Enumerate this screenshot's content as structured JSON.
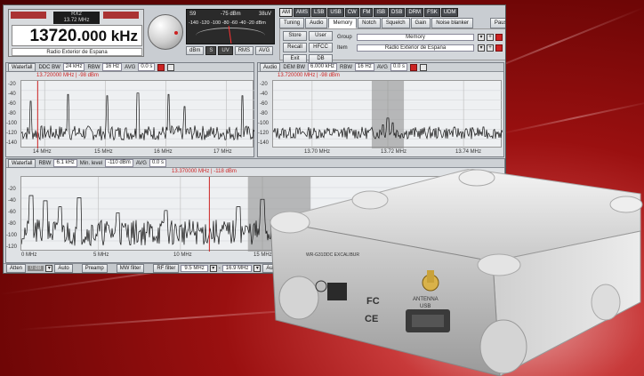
{
  "rx": {
    "label": "RX2",
    "sub": "13.72 MHz"
  },
  "frequency": {
    "main": "13720.",
    "unit": "000 kHz"
  },
  "station": "Radio Exterior de Espana",
  "meter": {
    "s_label": "S9",
    "dbm": "-75 dBm",
    "uv": "38uV",
    "scale": "-140 -120 -100 -80 -60 -40 -20 dBm"
  },
  "meter_buttons": [
    "dBm",
    "S",
    "UV",
    "RMS",
    "AVG"
  ],
  "modes": [
    "AM",
    "AMS",
    "LSB",
    "USB",
    "CW",
    "FM",
    "ISB",
    "DSB",
    "DRM",
    "FSK",
    "UDM"
  ],
  "tabs": [
    "Tuning",
    "Audio",
    "Memory",
    "Notch",
    "Squelch",
    "Gain",
    "Noise blanker",
    "Pause"
  ],
  "memory": {
    "buttons": [
      "Store",
      "User",
      "Recall",
      "HFCC",
      "Exit",
      "DB"
    ],
    "group_label": "Group",
    "group_value": "Memory",
    "item_label": "Item",
    "item_value": "Radio Exterior de Espana"
  },
  "waterfall1": {
    "label": "Waterfall",
    "ddc_label": "DDC BW",
    "ddc_value": "24 kHz",
    "rbw_label": "RBW",
    "rbw_value": "16 Hz",
    "avg_label": "AVG",
    "avg_value": "0.0 s",
    "marker": "13.720000 MHz | -98 dBm",
    "y_ticks": [
      "-20",
      "-40",
      "-60",
      "-80",
      "-100",
      "-120",
      "-140"
    ],
    "x_ticks": [
      "14 MHz",
      "15 MHz",
      "16 MHz",
      "17 MHz"
    ]
  },
  "audio": {
    "label": "Audio",
    "dem_label": "DEM BW",
    "dem_value": "6.000 kHz",
    "rbw_label": "RBW",
    "rbw_value": "16 Hz",
    "avg_label": "AVG",
    "avg_value": "0.0 s",
    "marker": "13.720000 MHz | -98 dBm",
    "y_ticks": [
      "-20",
      "-40",
      "-60",
      "-80",
      "-100",
      "-120",
      "-140"
    ],
    "x_ticks": [
      "13.70 MHz",
      "13.72 MHz",
      "13.74 MHz"
    ]
  },
  "waterfall2": {
    "label": "Waterfall",
    "rbw_label": "RBW",
    "rbw_value": "6.1 kHz",
    "min_label": "Min. level",
    "min_value": "-110 dBm",
    "avg_label": "AVG",
    "avg_value": "0.0 s",
    "marker": "13.370000 MHz | -118 dBm",
    "y_ticks": [
      "-20",
      "-40",
      "-60",
      "-80",
      "-100",
      "-120"
    ],
    "x_ticks": [
      "0 MHz",
      "5 MHz",
      "10 MHz",
      "15 MHz"
    ]
  },
  "bottom": {
    "atten": "Atten",
    "atten_val": "0 dB",
    "auto": "Auto",
    "preamp": "Preamp",
    "mw": "MW filter",
    "rf": "RF filter",
    "rf_val": "9.5 MHz",
    "dash": "-",
    "rf_val2": "16.9 MHz",
    "au": "Au"
  },
  "device": {
    "model": "WR-G31DDC EXCALIBUR",
    "antenna": "ANTENNA",
    "usb": "USB",
    "fcc": "FC",
    "ce": "CE"
  },
  "colors": {
    "accent_red": "#c22222",
    "panel": "#dfe2e5",
    "background": "#8a0a0a"
  }
}
